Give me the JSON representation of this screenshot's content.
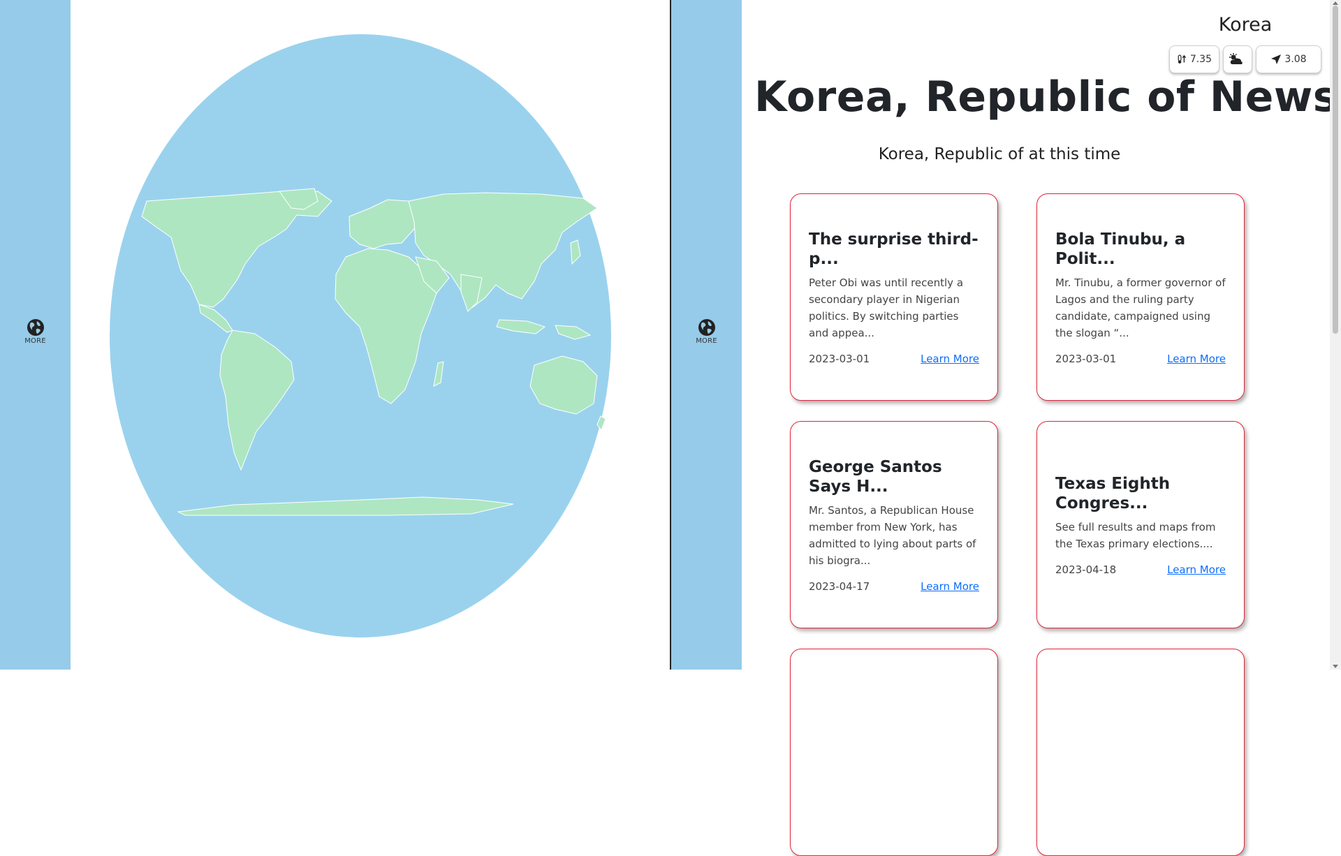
{
  "colors": {
    "ocean": "#9ad2ee",
    "land": "#aee6c2",
    "strip": "#96cbe9",
    "card_border": "#e0263a",
    "link": "#0d6efd"
  },
  "left_sidebar": {
    "more_label": "MORE",
    "icon": "globe-icon"
  },
  "right_sidebar": {
    "more_label": "MORE",
    "icon": "globe-icon"
  },
  "header": {
    "country": "Korea",
    "temperature": "7.35",
    "temperature_icon": "thermometer-up-icon",
    "weather_icon": "cloud-sun-icon",
    "wind": "3.08",
    "wind_icon": "navigation-arrow-icon"
  },
  "news": {
    "title": "Korea, Republic of News",
    "subtitle": "Korea, Republic of at this time",
    "link_label": "Learn More",
    "cards": [
      {
        "title": "The surprise third-p...",
        "description": "Peter Obi was until recently a secondary player in Nigerian politics. By switching parties and appea...",
        "date": "2023-03-01"
      },
      {
        "title": "Bola Tinubu, a Polit...",
        "description": "Mr. Tinubu, a former governor of Lagos and the ruling party candidate, campaigned using the slogan “...",
        "date": "2023-03-01"
      },
      {
        "title": "George Santos Says H...",
        "description": "Mr. Santos, a Republican House member from New York, has admitted to lying about parts of his biogra...",
        "date": "2023-04-17"
      },
      {
        "title": "Texas Eighth Congres...",
        "description": "See full results and maps from the Texas primary elections....",
        "date": "2023-04-18"
      }
    ]
  }
}
